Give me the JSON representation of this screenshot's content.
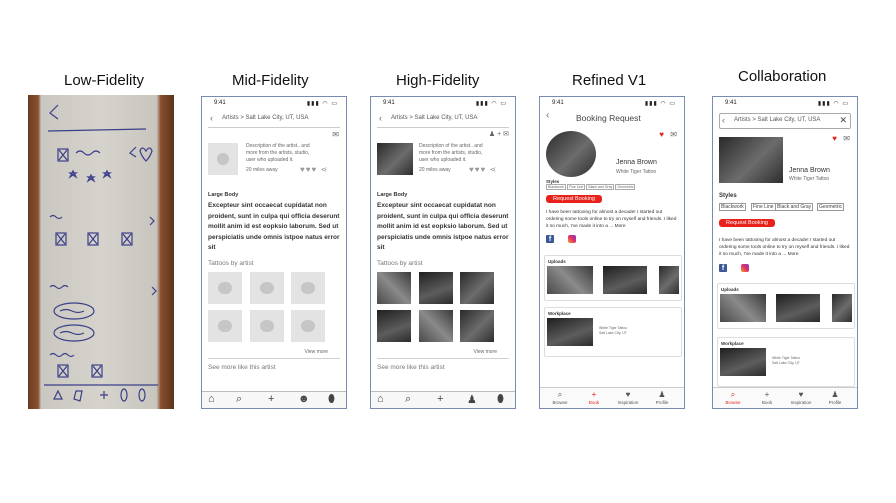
{
  "titles": [
    "Low-Fidelity",
    "Mid-Fidelity",
    "High-Fidelity",
    "Refined V1",
    "Collaboration"
  ],
  "status_time": "9:41",
  "status_icons": "▮▮▮ ◠ ▭",
  "breadcrumb": "Artists > Salt Lake City, UT, USA",
  "description": "Description of the artist.. and more from the artists, studio, user who uploaded it.",
  "distance": "20 miles away",
  "large_body_label": "Large Body",
  "large_body_text": "Excepteur sint occaecat cupidatat non proident, sunt in culpa qui officia deserunt mollit anim id est eopksio laborum. Sed ut perspiciatis unde omnis istpoe natus error sit",
  "tattoos_by_artist": "Tattoos by artist",
  "view_more": "View more",
  "see_more": "See more like this artist",
  "booking_request": "Booking Request",
  "artist_name": "Jenna Brown",
  "studio": "White Tiger Tattoo",
  "styles_label": "Styles",
  "styles": [
    "Blackwork",
    "Fine Line",
    "Black and Gray",
    "Geometric"
  ],
  "request_button": "Request Booking",
  "bio_v1": "I have been tattooing for almost a decade!  I started out ordering some tools online to try on myself and friends.  I liked it so much, I've made it into a ... More",
  "bio_collab": "I have been tattooing for almost a decade! I started out ordering some tools online to try on myself and friends.  I liked it so much, I've made it into a ... More",
  "uploads_label": "Uploads",
  "workplace_label": "Workplace",
  "workplace_name": "White Tiger Tattoo",
  "workplace_address": "Salt Lake City, UT",
  "tabs": [
    "Browse",
    "Book",
    "Inspiration",
    "Profile"
  ],
  "colors": {
    "accent": "#e8221b",
    "phone_border": "#7a8bb0",
    "placeholder": "#e3e3e3"
  }
}
